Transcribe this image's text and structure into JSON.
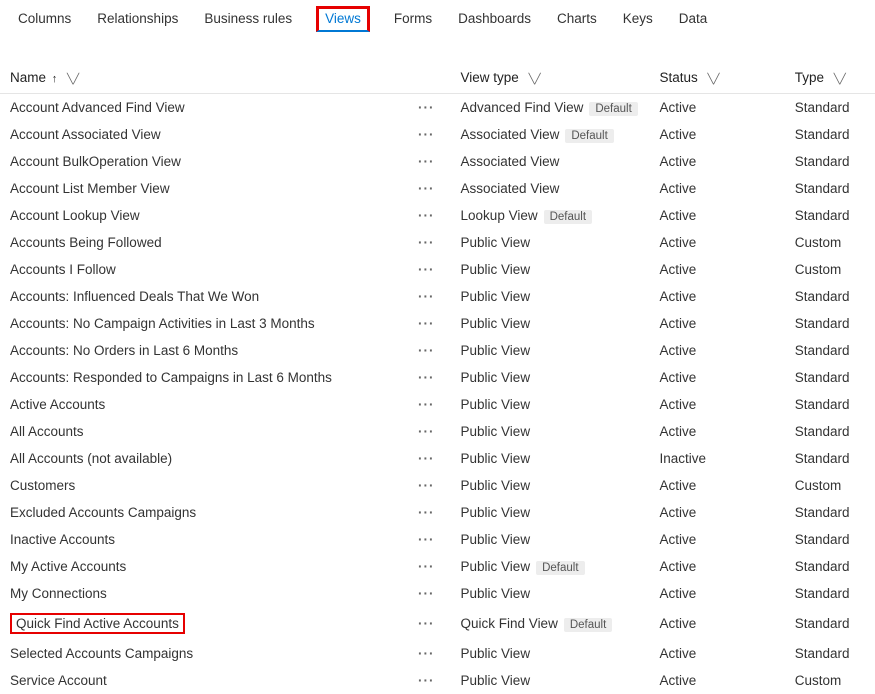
{
  "tabs": {
    "columns": "Columns",
    "relationships": "Relationships",
    "business_rules": "Business rules",
    "views": "Views",
    "forms": "Forms",
    "dashboards": "Dashboards",
    "charts": "Charts",
    "keys": "Keys",
    "data": "Data"
  },
  "headers": {
    "name": "Name",
    "view_type": "View type",
    "status": "Status",
    "type": "Type"
  },
  "badge_default": "Default",
  "rows": [
    {
      "name": "Account Advanced Find View",
      "view_type": "Advanced Find View",
      "default": true,
      "status": "Active",
      "type": "Standard",
      "highlight": false
    },
    {
      "name": "Account Associated View",
      "view_type": "Associated View",
      "default": true,
      "status": "Active",
      "type": "Standard",
      "highlight": false
    },
    {
      "name": "Account BulkOperation View",
      "view_type": "Associated View",
      "default": false,
      "status": "Active",
      "type": "Standard",
      "highlight": false
    },
    {
      "name": "Account List Member View",
      "view_type": "Associated View",
      "default": false,
      "status": "Active",
      "type": "Standard",
      "highlight": false
    },
    {
      "name": "Account Lookup View",
      "view_type": "Lookup View",
      "default": true,
      "status": "Active",
      "type": "Standard",
      "highlight": false
    },
    {
      "name": "Accounts Being Followed",
      "view_type": "Public View",
      "default": false,
      "status": "Active",
      "type": "Custom",
      "highlight": false
    },
    {
      "name": "Accounts I Follow",
      "view_type": "Public View",
      "default": false,
      "status": "Active",
      "type": "Custom",
      "highlight": false
    },
    {
      "name": "Accounts: Influenced Deals That We Won",
      "view_type": "Public View",
      "default": false,
      "status": "Active",
      "type": "Standard",
      "highlight": false
    },
    {
      "name": "Accounts: No Campaign Activities in Last 3 Months",
      "view_type": "Public View",
      "default": false,
      "status": "Active",
      "type": "Standard",
      "highlight": false
    },
    {
      "name": "Accounts: No Orders in Last 6 Months",
      "view_type": "Public View",
      "default": false,
      "status": "Active",
      "type": "Standard",
      "highlight": false
    },
    {
      "name": "Accounts: Responded to Campaigns in Last 6 Months",
      "view_type": "Public View",
      "default": false,
      "status": "Active",
      "type": "Standard",
      "highlight": false
    },
    {
      "name": "Active Accounts",
      "view_type": "Public View",
      "default": false,
      "status": "Active",
      "type": "Standard",
      "highlight": false
    },
    {
      "name": "All Accounts",
      "view_type": "Public View",
      "default": false,
      "status": "Active",
      "type": "Standard",
      "highlight": false
    },
    {
      "name": "All Accounts (not available)",
      "view_type": "Public View",
      "default": false,
      "status": "Inactive",
      "type": "Standard",
      "highlight": false
    },
    {
      "name": "Customers",
      "view_type": "Public View",
      "default": false,
      "status": "Active",
      "type": "Custom",
      "highlight": false
    },
    {
      "name": "Excluded Accounts Campaigns",
      "view_type": "Public View",
      "default": false,
      "status": "Active",
      "type": "Standard",
      "highlight": false
    },
    {
      "name": "Inactive Accounts",
      "view_type": "Public View",
      "default": false,
      "status": "Active",
      "type": "Standard",
      "highlight": false
    },
    {
      "name": "My Active Accounts",
      "view_type": "Public View",
      "default": true,
      "status": "Active",
      "type": "Standard",
      "highlight": false
    },
    {
      "name": "My Connections",
      "view_type": "Public View",
      "default": false,
      "status": "Active",
      "type": "Standard",
      "highlight": false
    },
    {
      "name": "Quick Find Active Accounts",
      "view_type": "Quick Find View",
      "default": true,
      "status": "Active",
      "type": "Standard",
      "highlight": true
    },
    {
      "name": "Selected Accounts Campaigns",
      "view_type": "Public View",
      "default": false,
      "status": "Active",
      "type": "Standard",
      "highlight": false
    },
    {
      "name": "Service Account",
      "view_type": "Public View",
      "default": false,
      "status": "Active",
      "type": "Custom",
      "highlight": false
    }
  ]
}
